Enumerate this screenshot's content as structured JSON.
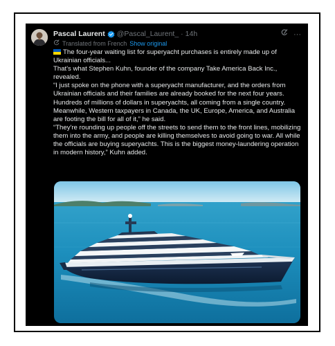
{
  "tweet": {
    "author_name": "Pascal Laurent",
    "handle": "@Pascal_Laurent_",
    "separator": "·",
    "time": "14h",
    "more_label": "···",
    "translated_label": "Translated from French",
    "show_original_label": "Show original",
    "paragraphs": [
      "The four-year waiting list for superyacht purchases is entirely made up of Ukrainian officials...",
      "That's what Stephen Kuhn, founder of the company Take America Back Inc., revealed.",
      "“I just spoke on the phone with a superyacht manufacturer, and the orders from Ukrainian officials and their families are already booked for the next four years. Hundreds of millions of dollars in superyachts, all coming from a single country. Meanwhile, Western taxpayers in Canada, the UK, Europe, America, and Australia are footing the bill for all of it,” he said.",
      "“They're rounding up people off the streets to send them to the front lines, mobilizing them into the army, and people are killing themselves to avoid going to war. All while the officials are buying superyachts. This is the biggest money-laundering operation in modern history,” Kuhn added."
    ],
    "icons": {
      "verified": "verified-badge-icon",
      "grok": "grok-icon",
      "more": "more-icon",
      "translate": "translate-icon",
      "flag": "ukraine-flag-icon"
    }
  },
  "colors": {
    "background": "#000000",
    "text": "#e7e9ea",
    "muted": "#71767b",
    "link": "#1d9bf0",
    "verified": "#1d9bf0"
  }
}
